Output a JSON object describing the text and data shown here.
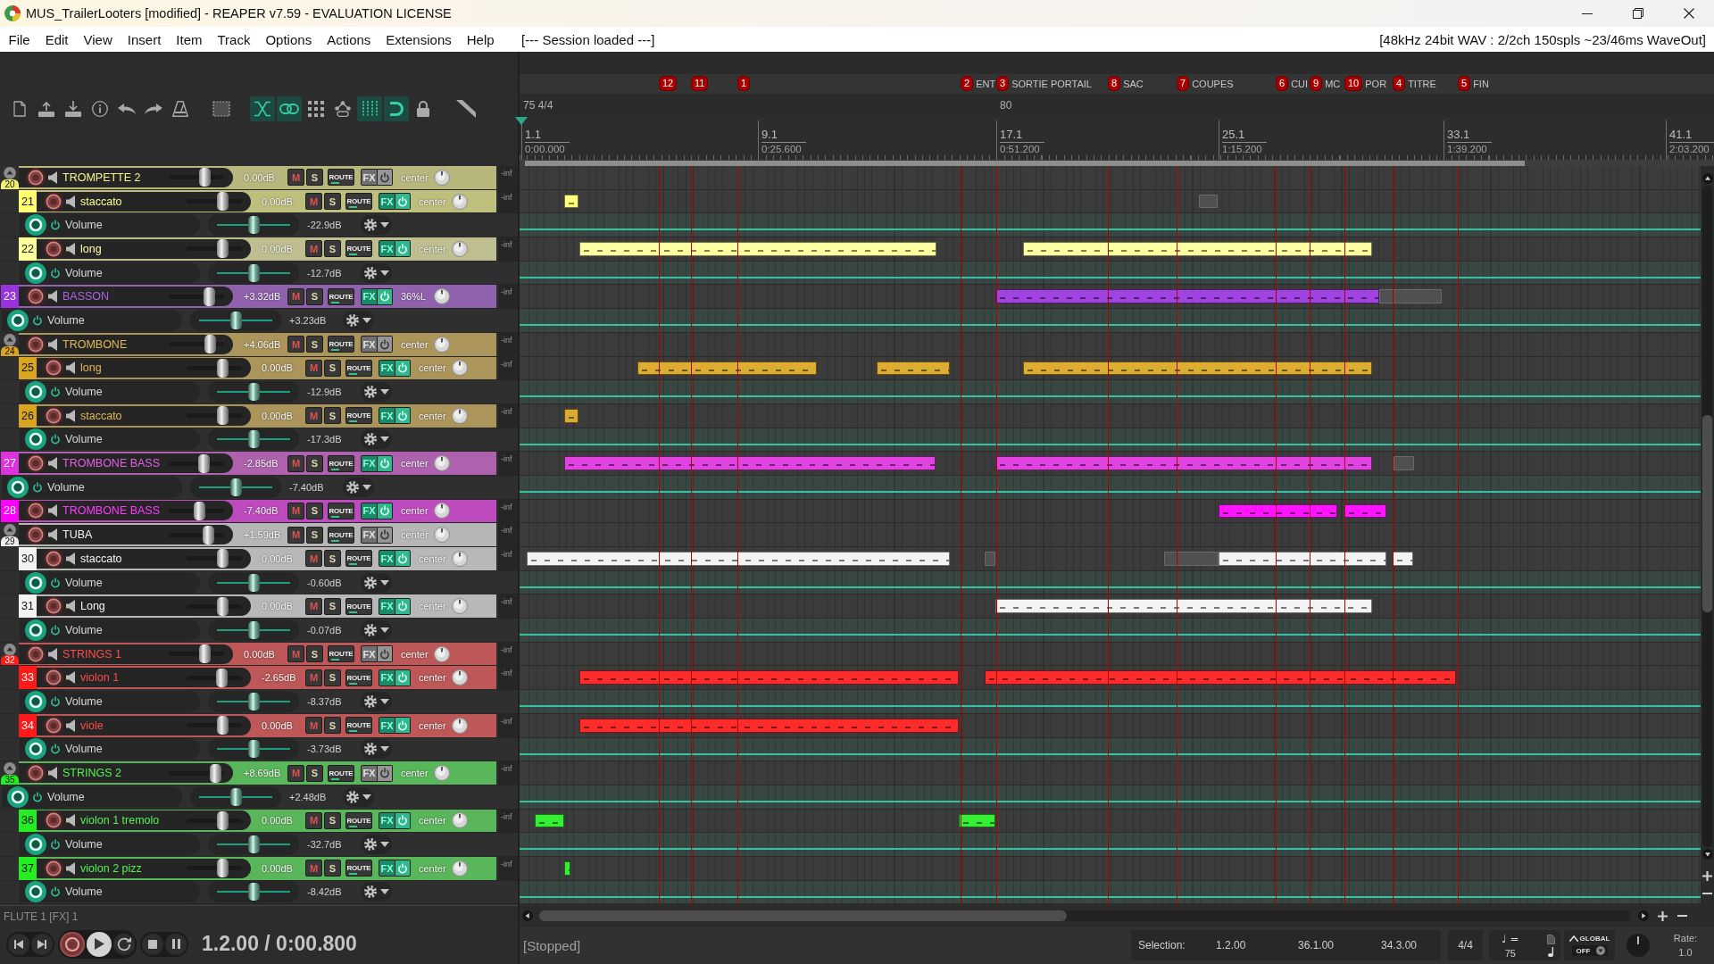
{
  "window": {
    "title": "MUS_TrailerLooters [modified] - REAPER v7.59 - EVALUATION LICENSE"
  },
  "menu": {
    "items": [
      "File",
      "Edit",
      "View",
      "Insert",
      "Item",
      "Track",
      "Options",
      "Actions",
      "Extensions",
      "Help"
    ],
    "status": "[--- Session loaded ---]",
    "audio_info": "[48kHz 24bit WAV : 2/2ch 150spls ~23/46ms WaveOut]"
  },
  "toolbar": [
    {
      "on": false
    },
    {
      "on": false
    },
    {
      "on": false
    },
    {
      "on": false
    },
    {
      "on": false
    },
    {
      "on": false
    },
    {
      "on": false
    },
    {
      "on": false
    },
    {
      "on": true
    },
    {
      "on": true
    },
    {
      "on": false
    },
    {
      "on": false
    },
    {
      "on": true
    },
    {
      "on": true
    },
    {
      "on": false
    },
    {
      "on": false
    }
  ],
  "markers": [
    {
      "number": "12"
    },
    {
      "number": "11"
    },
    {
      "number": "1"
    },
    {
      "number": "2",
      "label": "ENT"
    },
    {
      "number": "3",
      "label": "SORTIE PORTAIL"
    },
    {
      "number": "8",
      "label": "SAC"
    },
    {
      "number": "7",
      "label": "COUPES"
    },
    {
      "number": "6",
      "label": "CUI"
    },
    {
      "number": "9",
      "label": "MC"
    },
    {
      "number": "10",
      "label": "POR"
    },
    {
      "number": "4",
      "label": "TITRE"
    },
    {
      "number": "5",
      "label": "FIN"
    }
  ],
  "tempo_lane": [
    "75 4/4",
    "80"
  ],
  "ruler": [
    {
      "bar": "1.1",
      "time": "0:00.000"
    },
    {
      "bar": "9.1",
      "time": "0:25.600"
    },
    {
      "bar": "17.1",
      "time": "0:51.200"
    },
    {
      "bar": "25.1",
      "time": "1:15.200"
    },
    {
      "bar": "33.1",
      "time": "1:39.200"
    },
    {
      "bar": "41.1",
      "time": "2:03.200"
    }
  ],
  "tracks": [
    {
      "number": "20",
      "name": "TROMPETTE 2",
      "color": "#f0f070",
      "volume": "0.00dB",
      "level": 0.66,
      "buttons": [
        "M",
        "S",
        "ROUTE",
        "FX"
      ],
      "fx_active": false,
      "pan": "center",
      "meter": "-inf",
      "children": [
        {
          "number": "21",
          "name": "staccato",
          "color": "#ffff70",
          "volume": "0.00dB",
          "level": 0.66,
          "buttons": [
            "M",
            "S",
            "ROUTE",
            "FX"
          ],
          "fx_active": true,
          "pan": "center",
          "meter": "-inf",
          "envelope": {
            "name": "Volume",
            "level": 0.5,
            "value": "-22.9dB"
          }
        },
        {
          "number": "22",
          "name": "long",
          "color": "#ffff99",
          "volume": "0.00dB",
          "level": 0.66,
          "buttons": [
            "M",
            "S",
            "ROUTE",
            "FX"
          ],
          "fx_active": true,
          "pan": "center",
          "meter": "-inf",
          "envelope": {
            "name": "Volume",
            "level": 0.5,
            "value": "-12.7dB"
          }
        }
      ]
    },
    {
      "number": "23",
      "name": "BASSON",
      "color": "#9933dd",
      "volume": "+3.32dB",
      "level": 0.74,
      "buttons": [
        "M",
        "S",
        "ROUTE",
        "FX"
      ],
      "fx_active": true,
      "pan": "36%L",
      "meter": "-inf",
      "envelope": {
        "name": "Volume",
        "level": 0.5,
        "value": "+3.23dB"
      }
    },
    {
      "number": "24",
      "name": "TROMBONE",
      "color": "#d9a521",
      "volume": "+4.06dB",
      "level": 0.75,
      "buttons": [
        "M",
        "S",
        "ROUTE",
        "FX"
      ],
      "fx_active": false,
      "pan": "center",
      "meter": "-inf",
      "children": [
        {
          "number": "25",
          "name": "long",
          "color": "#d9a521",
          "volume": "0.00dB",
          "level": 0.66,
          "buttons": [
            "M",
            "S",
            "ROUTE",
            "FX"
          ],
          "fx_active": true,
          "pan": "center",
          "meter": "-inf",
          "envelope": {
            "name": "Volume",
            "level": 0.5,
            "value": "-12.9dB"
          }
        },
        {
          "number": "26",
          "name": "staccato",
          "color": "#d9a521",
          "volume": "0.00dB",
          "level": 0.66,
          "buttons": [
            "M",
            "S",
            "ROUTE",
            "FX"
          ],
          "fx_active": true,
          "pan": "center",
          "meter": "-inf",
          "envelope": {
            "name": "Volume",
            "level": 0.5,
            "value": "-17.3dB"
          }
        }
      ]
    },
    {
      "number": "27",
      "name": "TROMBONE BASS",
      "color": "#dd33dd",
      "volume": "-2.85dB",
      "level": 0.63,
      "buttons": [
        "M",
        "S",
        "ROUTE",
        "FX"
      ],
      "fx_active": true,
      "pan": "center",
      "meter": "-inf",
      "envelope": {
        "name": "Volume",
        "level": 0.5,
        "value": "-7.40dB"
      }
    },
    {
      "number": "28",
      "name": "TROMBONE BASS",
      "color": "#ff00ff",
      "volume": "-7.40dB",
      "level": 0.55,
      "buttons": [
        "M",
        "S",
        "ROUTE",
        "FX"
      ],
      "fx_active": true,
      "pan": "center",
      "meter": "-inf"
    },
    {
      "number": "29",
      "name": "TUBA",
      "color": "#eeeeee",
      "volume": "+1.59dB",
      "level": 0.71,
      "buttons": [
        "M",
        "S",
        "ROUTE",
        "FX"
      ],
      "fx_active": false,
      "pan": "center",
      "meter": "-inf",
      "children": [
        {
          "number": "30",
          "name": "staccato",
          "color": "#f2f2f2",
          "volume": "0.00dB",
          "level": 0.66,
          "buttons": [
            "M",
            "S",
            "ROUTE",
            "FX"
          ],
          "fx_active": true,
          "pan": "center",
          "meter": "-inf",
          "envelope": {
            "name": "Volume",
            "level": 0.5,
            "value": "-0.60dB"
          }
        },
        {
          "number": "31",
          "name": "Long",
          "color": "#f2f2f2",
          "volume": "0.00dB",
          "level": 0.66,
          "buttons": [
            "M",
            "S",
            "ROUTE",
            "FX"
          ],
          "fx_active": true,
          "pan": "center",
          "meter": "-inf",
          "envelope": {
            "name": "Volume",
            "level": 0.5,
            "value": "-0.07dB"
          }
        }
      ]
    },
    {
      "number": "32",
      "name": "STRINGS 1",
      "color": "#ff1a1a",
      "volume": "0.00dB",
      "level": 0.66,
      "buttons": [
        "M",
        "S",
        "ROUTE",
        "FX"
      ],
      "fx_active": false,
      "pan": "center",
      "meter": "-inf",
      "children": [
        {
          "number": "33",
          "name": "violon 1",
          "color": "#ff1a1a",
          "volume": "-2.65dB",
          "level": 0.63,
          "buttons": [
            "M",
            "S",
            "ROUTE",
            "FX"
          ],
          "fx_active": true,
          "pan": "center",
          "meter": "-inf",
          "envelope": {
            "name": "Volume",
            "level": 0.5,
            "value": "-8.37dB"
          }
        },
        {
          "number": "34",
          "name": "viole",
          "color": "#ff1a1a",
          "volume": "0.00dB",
          "level": 0.66,
          "buttons": [
            "M",
            "S",
            "ROUTE",
            "FX"
          ],
          "fx_active": true,
          "pan": "center",
          "meter": "-inf",
          "envelope": {
            "name": "Volume",
            "level": 0.5,
            "value": "-3.73dB"
          }
        }
      ]
    },
    {
      "number": "35",
      "name": "STRINGS 2",
      "color": "#22ee22",
      "volume": "+8.69dB",
      "level": 0.85,
      "buttons": [
        "M",
        "S",
        "ROUTE",
        "FX"
      ],
      "fx_active": false,
      "pan": "center",
      "meter": "-inf",
      "envelope": {
        "name": "Volume",
        "level": 0.5,
        "value": "+2.48dB"
      },
      "children": [
        {
          "number": "36",
          "name": "violon 1 tremolo",
          "color": "#22ee22",
          "volume": "0.00dB",
          "level": 0.66,
          "buttons": [
            "M",
            "S",
            "ROUTE",
            "FX"
          ],
          "fx_active": true,
          "pan": "center",
          "meter": "-inf",
          "envelope": {
            "name": "Volume",
            "level": 0.5,
            "value": "-32.7dB"
          }
        },
        {
          "number": "37",
          "name": "violon 2 pizz",
          "color": "#22ee22",
          "volume": "0.00dB",
          "level": 0.66,
          "buttons": [
            "M",
            "S",
            "ROUTE",
            "FX"
          ],
          "fx_active": true,
          "pan": "center",
          "meter": "-inf",
          "envelope": {
            "name": "Volume",
            "level": 0.5,
            "value": "-8.42dB"
          }
        }
      ]
    }
  ],
  "track_panel_footer": {
    "selected_track": "FLUTE 1 [FX] 1",
    "position": "1.2.00 / 0:00.800"
  },
  "status_bar": {
    "play_state": "[Stopped]",
    "selection": {
      "label": "Selection:",
      "start": "1.2.00",
      "end": "36.1.00",
      "length": "34.3.00"
    },
    "time_signature": "4/4",
    "tempo": {
      "symbol": "♩ =",
      "value": "75"
    },
    "envelope_mode": {
      "label": "GLOBAL",
      "value": "OFF"
    },
    "rate": {
      "label": "Rate:",
      "value": "1.0"
    }
  }
}
